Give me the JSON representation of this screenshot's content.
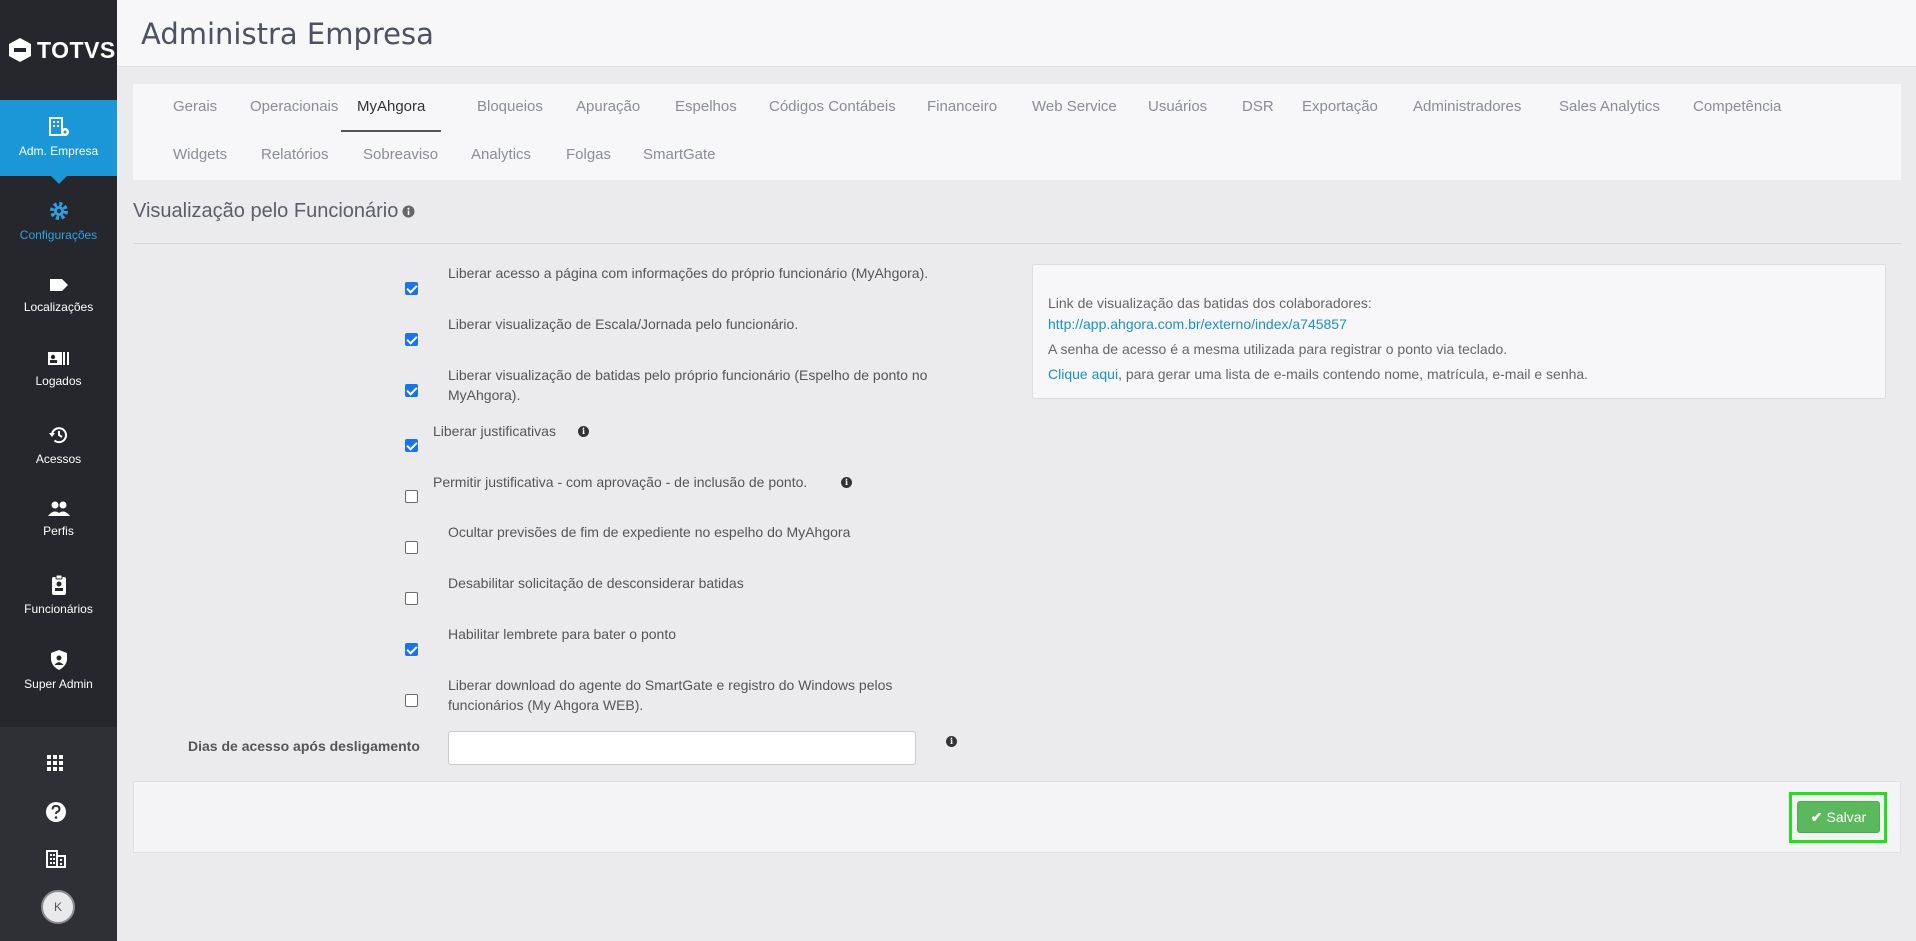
{
  "app": {
    "logo_text": "TOTVS"
  },
  "sidebar": {
    "items": [
      {
        "label": "Adm. Empresa",
        "icon": "building-gear-icon"
      },
      {
        "label": "Configurações",
        "icon": "gear-icon"
      },
      {
        "label": "Localizações",
        "icon": "tag-icon"
      },
      {
        "label": "Logados",
        "icon": "id-card-icon"
      },
      {
        "label": "Acessos",
        "icon": "history-icon"
      },
      {
        "label": "Perfis",
        "icon": "users-icon"
      },
      {
        "label": "Funcionários",
        "icon": "clipboard-user-icon"
      },
      {
        "label": "Super Admin",
        "icon": "shield-user-icon"
      }
    ],
    "bottom": {
      "icons": [
        "apps-grid-icon",
        "help-icon",
        "company-icon"
      ],
      "avatar_initial": "K"
    }
  },
  "header": {
    "title": "Administra Empresa"
  },
  "tabs": [
    "Gerais",
    "Operacionais",
    "MyAhgora",
    "Bloqueios",
    "Apuração",
    "Espelhos",
    "Códigos Contábeis",
    "Financeiro",
    "Web Service",
    "Usuários",
    "DSR",
    "Exportação",
    "Administradores",
    "Sales Analytics",
    "Competência",
    "Widgets",
    "Relatórios",
    "Sobreaviso",
    "Analytics",
    "Folgas",
    "SmartGate"
  ],
  "active_tab": "MyAhgora",
  "section": {
    "title": "Visualização pelo Funcionário"
  },
  "options": [
    {
      "label": "Liberar acesso a página com informações do próprio funcionário (MyAhgora).",
      "checked": true
    },
    {
      "label": "Liberar visualização de Escala/Jornada pelo funcionário.",
      "checked": true
    },
    {
      "label": "Liberar visualização de batidas pelo próprio funcionário (Espelho de ponto no MyAhgora).",
      "checked": true
    },
    {
      "label": "Liberar justificativas",
      "checked": true
    },
    {
      "label": "Permitir justificativa - com aprovação - de inclusão de ponto.",
      "checked": false
    },
    {
      "label": "Ocultar previsões de fim de expediente no espelho do MyAhgora",
      "checked": false
    },
    {
      "label": "Desabilitar solicitação de desconsiderar batidas",
      "checked": false
    },
    {
      "label": "Habilitar lembrete para bater o ponto",
      "checked": true
    },
    {
      "label": "Liberar download do agente do SmartGate e registro do Windows pelos funcionários (My Ahgora WEB).",
      "checked": false
    }
  ],
  "dias": {
    "label": "Dias de acesso após desligamento",
    "value": ""
  },
  "info_box": {
    "line1": "Link de visualização das batidas dos colaboradores:",
    "link": "http://app.ahgora.com.br/externo/index/a745857",
    "line3": "A senha de acesso é a mesma utilizada para registrar o ponto via teclado.",
    "click_here": "Clique aqui",
    "line4_rest": ", para gerar uma lista de e-mails contendo nome, matrícula, e-mail e senha."
  },
  "footer": {
    "save_label": "Salvar"
  },
  "colors": {
    "sidebar": "#26272c",
    "active": "#1b96d6",
    "save": "#5cb85c",
    "highlight": "#22e01a"
  }
}
